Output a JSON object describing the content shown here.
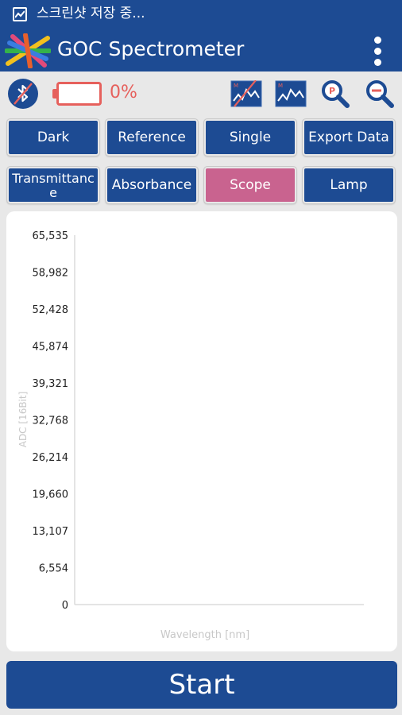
{
  "status_bar": {
    "text": "스크린샷 저장 중..."
  },
  "app_bar": {
    "title": "GOC Spectrometer"
  },
  "toolbar": {
    "battery_percent": "0%",
    "colors": {
      "battery": "#e6605c"
    }
  },
  "buttons": {
    "row1": [
      "Dark",
      "Reference",
      "Single",
      "Export Data"
    ],
    "row2": [
      "Transmittance",
      "Absorbance",
      "Scope",
      "Lamp"
    ]
  },
  "theme": {
    "primary": "#1d4b93",
    "active_mode": "#c9638f"
  },
  "chart_data": {
    "type": "line",
    "title": "",
    "xlabel": "Wavelength [nm]",
    "ylabel": "ADC [16Bit]",
    "y_ticks": [
      "65,535",
      "58,982",
      "52,428",
      "45,874",
      "39,321",
      "32,768",
      "26,214",
      "19,660",
      "13,107",
      "6,554",
      "0"
    ],
    "ylim": [
      0,
      65535
    ],
    "grid": false,
    "series": []
  },
  "start_button": {
    "label": "Start"
  }
}
